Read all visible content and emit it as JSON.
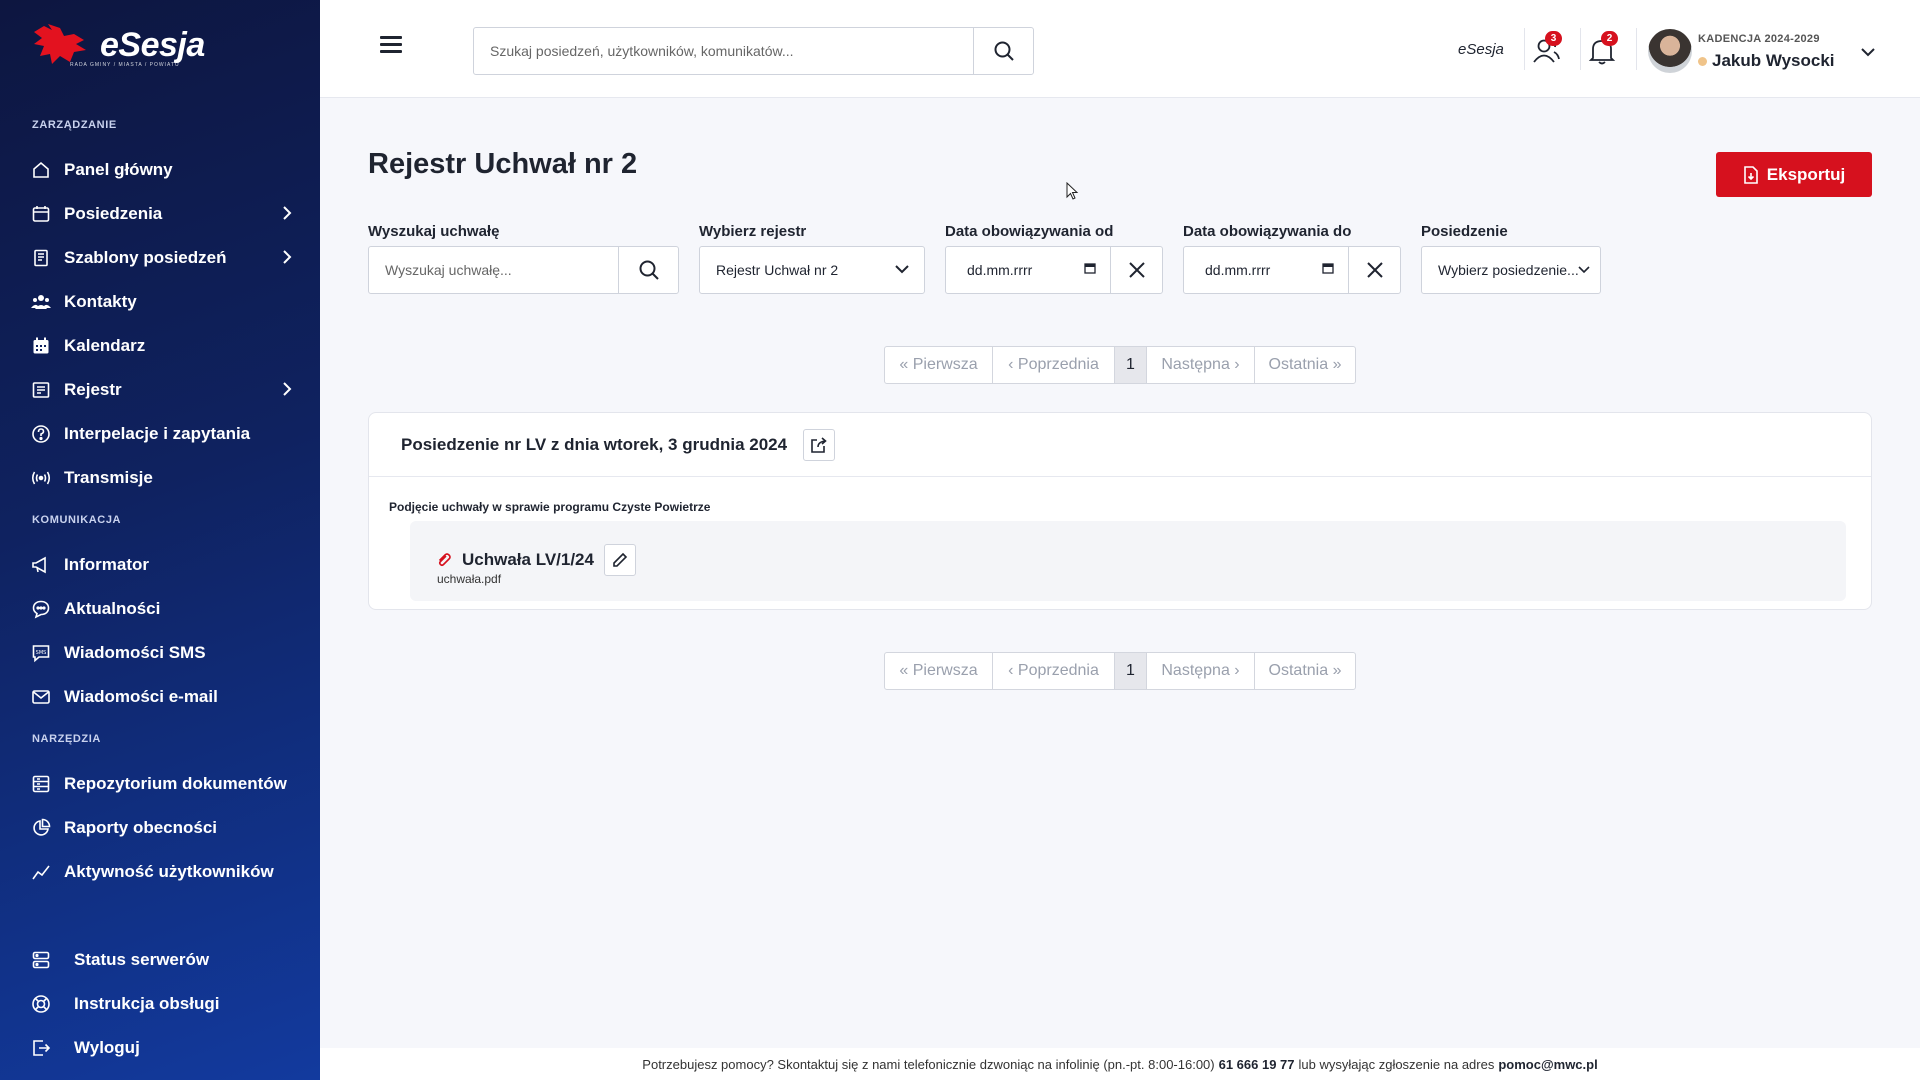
{
  "sidebar": {
    "brand": "eSesja",
    "brand_sub": "RADA GMINY / MIASTA / POWIATU",
    "sections": {
      "management": "ZARZĄDZANIE",
      "communication": "KOMUNIKACJA",
      "tools": "NARZĘDZIA"
    },
    "items": [
      {
        "label": "Panel główny",
        "icon": "home-icon"
      },
      {
        "label": "Posiedzenia",
        "icon": "calendar-icon",
        "expandable": true
      },
      {
        "label": "Szablony posiedzeń",
        "icon": "template-icon",
        "expandable": true
      },
      {
        "label": "Kontakty",
        "icon": "contacts-icon"
      },
      {
        "label": "Kalendarz",
        "icon": "calendar-grid-icon"
      },
      {
        "label": "Rejestr",
        "icon": "register-icon",
        "expandable": true
      },
      {
        "label": "Interpelacje i zapytania",
        "icon": "question-icon"
      },
      {
        "label": "Transmisje",
        "icon": "broadcast-icon"
      },
      {
        "label": "Informator",
        "icon": "megaphone-icon"
      },
      {
        "label": "Aktualności",
        "icon": "chat-bubble-icon"
      },
      {
        "label": "Wiadomości SMS",
        "icon": "sms-icon"
      },
      {
        "label": "Wiadomości e-mail",
        "icon": "mail-icon"
      },
      {
        "label": "Repozytorium dokumentów",
        "icon": "repository-icon"
      },
      {
        "label": "Raporty obecności",
        "icon": "pie-chart-icon"
      },
      {
        "label": "Aktywność użytkowników",
        "icon": "line-chart-icon"
      },
      {
        "label": "Status serwerów",
        "icon": "server-icon"
      },
      {
        "label": "Instrukcja obsługi",
        "icon": "lifebuoy-icon"
      },
      {
        "label": "Wyloguj",
        "icon": "logout-icon"
      }
    ]
  },
  "header": {
    "search_placeholder": "Szukaj posiedzeń, użytkowników, komunikatów...",
    "brand": "eSesja",
    "users_badge": "3",
    "notifications_badge": "2",
    "term": "KADENCJA 2024-2029",
    "user_name": "Jakub Wysocki"
  },
  "main": {
    "title": "Rejestr Uchwał nr 2",
    "export_label": "Eksportuj",
    "filters": {
      "search_label": "Wyszukaj uchwałę",
      "search_placeholder": "Wyszukaj uchwałę...",
      "register_label": "Wybierz rejestr",
      "register_value": "Rejestr Uchwał nr 2",
      "date_from_label": "Data obowiązywania od",
      "date_from_value": "dd.mm.rrrr",
      "date_to_label": "Data obowiązywania do",
      "date_to_value": "dd.mm.rrrr",
      "session_label": "Posiedzenie",
      "session_value": "Wybierz posiedzenie..."
    },
    "pagination": {
      "first": "« Pierwsza",
      "prev": "‹ Poprzednia",
      "current": "1",
      "next": "Następna ›",
      "last": "Ostatnia »"
    },
    "session": {
      "title": "Posiedzenie nr LV z dnia wtorek, 3 grudnia 2024",
      "subject": "Podjęcie uchwały w sprawie programu Czyste Powietrze",
      "resolution": "Uchwała LV/1/24",
      "file": "uchwała.pdf"
    }
  },
  "footer": {
    "text": "Potrzebujesz pomocy? Skontaktuj się z nami telefonicznie dzwoniąc na infolinię (pn.-pt. 8:00-16:00)",
    "phone": "61 666 19 77",
    "middle": "lub wysyłając zgłoszenie na adres",
    "email": "pomoc@mwc.pl"
  },
  "colors": {
    "accent": "#d6111e",
    "sidebar_dark": "#0d1640",
    "sidebar_light": "#123a9e"
  }
}
